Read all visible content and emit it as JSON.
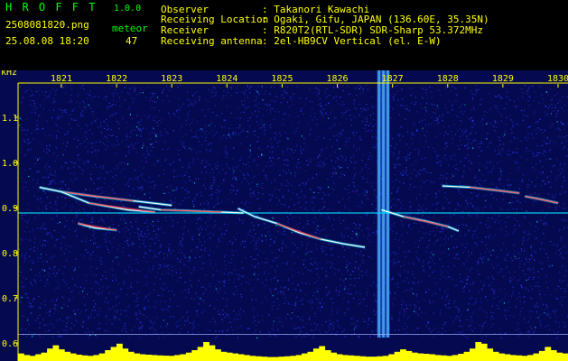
{
  "header": {
    "app_title": "H R O F F T",
    "app_version": "1.0.0",
    "filename": "2508081820.png",
    "meteor_label": "meteor",
    "datetime": "25.08.08 18:20",
    "meteor_count": "47",
    "info": [
      {
        "label": "Observer",
        "value": ": Takanori Kawachi"
      },
      {
        "label": "Receiving Location",
        "value": ": Ogaki, Gifu, JAPAN (136.60E, 35.35N)"
      },
      {
        "label": "Receiver",
        "value": ": R820T2(RTL-SDR) SDR-Sharp 53.372MHz"
      },
      {
        "label": "Receiving antenna",
        "value": ": 2el-HB9CV Vertical (el. E-W)"
      }
    ]
  },
  "chart_data": {
    "type": "heatmap",
    "y_unit_label": "kHz",
    "x_tick_labels": [
      "1821",
      "1822",
      "1823",
      "1824",
      "1825",
      "1826",
      "1827",
      "1828",
      "1829",
      "1830"
    ],
    "y_tick_labels": [
      "1.1",
      "1.0",
      "0.9",
      "0.8",
      "0.7",
      "0.6"
    ],
    "ylim": [
      0.58,
      1.2
    ],
    "xlim": [
      1820.6,
      1830.0
    ],
    "carrier_frequency_khz": 0.888,
    "colors": {
      "background": "#0a0f6a",
      "noise": "#2a3cff",
      "signal_hot": "#ff3040",
      "signal_mid": "#00e0ff",
      "signal_soft": "#ffffff",
      "level_bars": "#ffff00",
      "axis_text": "#ffff00"
    },
    "meteor_traces": [
      {
        "x": [
          1820.6,
          1821.0,
          1821.6,
          1822.3,
          1823.0
        ],
        "y": [
          0.945,
          0.935,
          0.925,
          0.915,
          0.905
        ]
      },
      {
        "x": [
          1821.0,
          1821.5,
          1822.2,
          1822.7
        ],
        "y": [
          0.935,
          0.91,
          0.895,
          0.89
        ]
      },
      {
        "x": [
          1821.3,
          1821.6,
          1822.0
        ],
        "y": [
          0.865,
          0.855,
          0.85
        ]
      },
      {
        "x": [
          1824.2,
          1824.5,
          1824.9,
          1825.3,
          1825.7,
          1826.1,
          1826.5
        ],
        "y": [
          0.898,
          0.88,
          0.865,
          0.845,
          0.83,
          0.82,
          0.812
        ]
      },
      {
        "x": [
          1826.8,
          1827.2,
          1827.6,
          1828.0,
          1828.2
        ],
        "y": [
          0.895,
          0.88,
          0.87,
          0.858,
          0.848
        ]
      },
      {
        "x": [
          1827.9,
          1828.4,
          1828.9,
          1829.3
        ],
        "y": [
          0.948,
          0.945,
          0.938,
          0.932
        ]
      },
      {
        "x": [
          1829.4,
          1829.7,
          1830.0
        ],
        "y": [
          0.925,
          0.918,
          0.91
        ]
      },
      {
        "x": [
          1822.4,
          1822.8,
          1823.3,
          1823.9,
          1824.3
        ],
        "y": [
          0.902,
          0.895,
          0.893,
          0.89,
          0.888
        ]
      }
    ],
    "interference_band_x": [
      1826.72,
      1826.95
    ],
    "level_bars": [
      30,
      20,
      15,
      25,
      35,
      60,
      80,
      55,
      40,
      30,
      22,
      18,
      15,
      20,
      30,
      50,
      70,
      90,
      60,
      40,
      30,
      25,
      22,
      20,
      18,
      16,
      15,
      20,
      25,
      35,
      50,
      70,
      100,
      80,
      55,
      40,
      35,
      30,
      25,
      20,
      15,
      12,
      10,
      8,
      8,
      10,
      12,
      15,
      20,
      30,
      40,
      60,
      75,
      50,
      35,
      25,
      20,
      18,
      15,
      12,
      10,
      10,
      12,
      15,
      25,
      40,
      55,
      45,
      35,
      30,
      28,
      25,
      20,
      18,
      15,
      20,
      28,
      40,
      60,
      100,
      90,
      60,
      40,
      30,
      25,
      20,
      18,
      15,
      20,
      30,
      45,
      70,
      50,
      35,
      30
    ]
  }
}
